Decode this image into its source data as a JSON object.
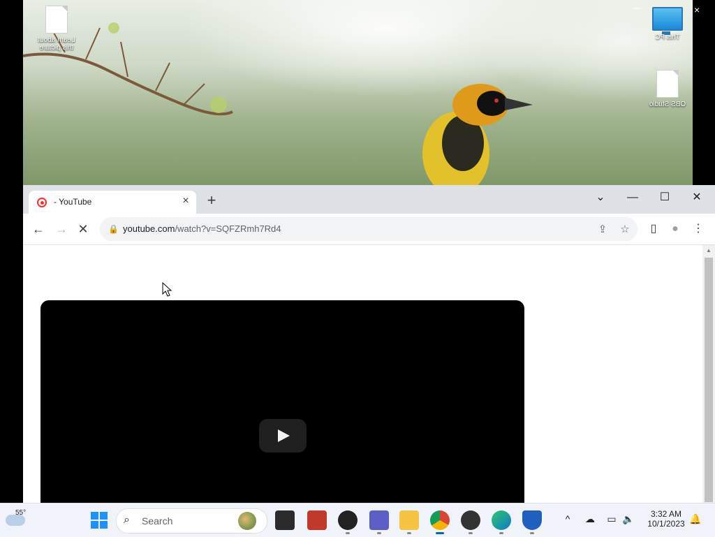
{
  "desktop": {
    "icons": [
      {
        "label": "Learn about this picture",
        "icon": "document-icon"
      },
      {
        "label": "This PC",
        "icon": "computer-icon"
      },
      {
        "label": "OBS Studio",
        "icon": "shortcut-icon"
      }
    ],
    "close_glyph": "×",
    "minimize_glyph": "—"
  },
  "browser": {
    "tab": {
      "title": "- YouTube",
      "close": "×"
    },
    "new_tab": "+",
    "window_controls": {
      "dropdown": "⌄",
      "minimize": "—",
      "maximize": "☐",
      "close": "✕"
    },
    "toolbar": {
      "back": "←",
      "forward": "→",
      "reload": "✕"
    },
    "omnibox": {
      "url_host": "youtube.com",
      "url_path": "/watch?v=SQFZRmh7Rd4"
    },
    "toolbar_icons": {
      "share": "⇪",
      "star": "☆",
      "sidepanel": "▯",
      "profile": "●",
      "menu": "⋮"
    }
  },
  "taskbar": {
    "weather": {
      "temp": "55°"
    },
    "search": {
      "placeholder": "Search"
    },
    "clock": {
      "time": "3:32 AM",
      "date": "10/1/2023"
    },
    "tray": {
      "chevron": "^",
      "onedrive": "☁",
      "network": "▭",
      "volume": "🔈",
      "notification": "🔔"
    },
    "apps": [
      {
        "name": "start",
        "color": "#1e90ff"
      },
      {
        "name": "task-view",
        "color": "#1f1f1f"
      },
      {
        "name": "photos",
        "color": "#c0392b"
      },
      {
        "name": "obs",
        "color": "#222"
      },
      {
        "name": "teams",
        "color": "#5b5fc7"
      },
      {
        "name": "file-explorer",
        "color": "#f6c343"
      },
      {
        "name": "chrome",
        "color": "#db4437"
      },
      {
        "name": "media-player",
        "color": "#333"
      },
      {
        "name": "edge",
        "color": "#0f7bc9"
      },
      {
        "name": "defender",
        "color": "#1f5fbf"
      }
    ]
  }
}
